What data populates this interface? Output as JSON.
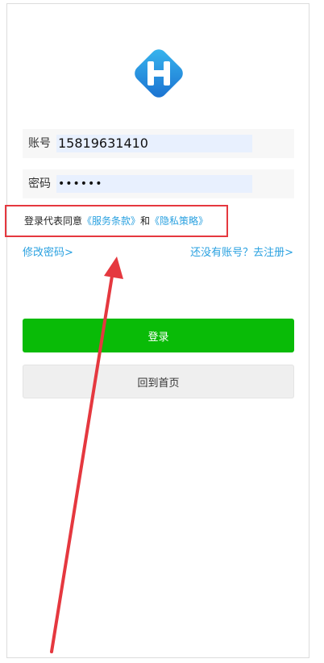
{
  "form": {
    "account_label": "账号",
    "account_value": "15819631410",
    "password_label": "密码",
    "password_value": "••••••"
  },
  "agreement": {
    "prefix": "登录代表同意",
    "terms_link": "《服务条款》",
    "connector": "和",
    "privacy_link": "《隐私策略》"
  },
  "links": {
    "change_password": "修改密码>",
    "register": "还没有账号？去注册>"
  },
  "buttons": {
    "login": "登录",
    "back_home": "回到首页"
  },
  "colors": {
    "primary_green": "#09bb07",
    "link_blue": "#2aa1e0",
    "annotation_red": "#e5383f"
  },
  "icons": {
    "logo": "app-logo-icon"
  }
}
